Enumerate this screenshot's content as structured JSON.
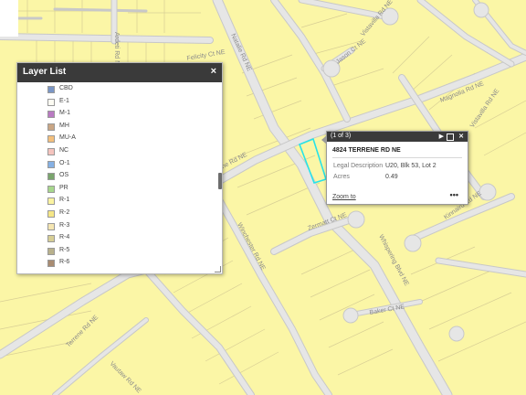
{
  "colors": {
    "land": "#fbf6a6",
    "road": "#dedede",
    "road_edge": "#c8c8c8",
    "parcel_line": "#d8cf95",
    "selection": "#27e3e8",
    "panel_header": "#3a3a3a"
  },
  "streets": {
    "felicity": "Felicity Ct NE",
    "natalie": "Natalie Rd NE",
    "jason": "Jason Ct NE",
    "vistavilla_top": "Vistavilla Rd NE",
    "vistavilla_right": "Vistavilla Rd NE",
    "terrene_mid": "Terrene Rd NE",
    "terrene_lower": "Terrene Rd NE",
    "winchester": "Winchester Rd NE",
    "zermatt": "Zermatt Ct NE",
    "whispering": "Whispering Blvd NE",
    "kinnaird": "Kinnaird Rd NE",
    "baker": "Baker Ct NE",
    "ardeti": "Ardeti Rd NE",
    "magnolia": "Magnolia Rd NE",
    "vautaw": "Vautaw Rd NE"
  },
  "layer_list": {
    "title": "Layer List",
    "close_icon": "×",
    "layers": [
      {
        "name": "CBD",
        "color": "#7a96c6"
      },
      {
        "name": "E-1",
        "color": "#fdfcf3"
      },
      {
        "name": "M-1",
        "color": "#b97ac2"
      },
      {
        "name": "MH",
        "color": "#c9a685"
      },
      {
        "name": "MU-A",
        "color": "#f4c07c"
      },
      {
        "name": "NC",
        "color": "#f5c4be"
      },
      {
        "name": "O-1",
        "color": "#86b1e4"
      },
      {
        "name": "OS",
        "color": "#7aa56d"
      },
      {
        "name": "PR",
        "color": "#a7d78c"
      },
      {
        "name": "R-1",
        "color": "#fbf3a1"
      },
      {
        "name": "R-2",
        "color": "#f5e686"
      },
      {
        "name": "R-3",
        "color": "#f5e6b2"
      },
      {
        "name": "R-4",
        "color": "#d7ce95"
      },
      {
        "name": "R-5",
        "color": "#b8b18c"
      },
      {
        "name": "R-6",
        "color": "#a98c72"
      }
    ]
  },
  "popup": {
    "counter": "(1 of 3)",
    "next_icon": "▶",
    "close_icon": "✕",
    "title": "4824 TERRENE RD NE",
    "fields": [
      {
        "label": "Legal Description",
        "value": "U20, Blk 53, Lot 2"
      },
      {
        "label": "Acres",
        "value": "0.49"
      }
    ],
    "zoom_label": "Zoom to",
    "more_icon": "•••"
  }
}
